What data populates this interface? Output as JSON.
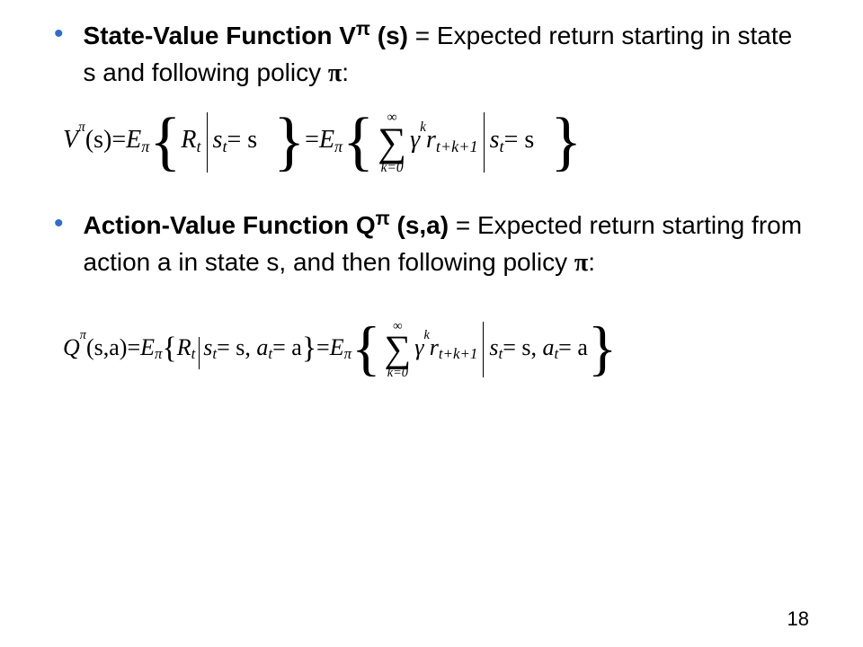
{
  "bullet1": {
    "title": "State-Value Function V",
    "title_sup": "π",
    "title_paren": " (s)",
    "desc": " = Expected return starting in state s and following policy ",
    "policy": "π",
    "colon": ":"
  },
  "eq1": {
    "V": "V",
    "pi": "π",
    "s_paren": "(s)",
    "eq": " = ",
    "E": "E",
    "lbrace": "{",
    "rbrace": "}",
    "R": "R",
    "t": "t",
    "mid": "|",
    "s_var": "s",
    "eq_s": " = s",
    "sum_top": "∞",
    "sum_bot": "k=0",
    "gamma": "γ",
    "k": "k",
    "r": "r",
    "tk1": "t+k+1"
  },
  "bullet2": {
    "title": "Action-Value Function Q",
    "title_sup": "π",
    "title_paren": " (s,a)",
    "desc": " = Expected return starting from action a in state s, and then following policy ",
    "policy": "π",
    "colon": ":"
  },
  "eq2": {
    "Q": "Q",
    "pi": "π",
    "sa_paren": "(s,a)",
    "eq": " = ",
    "E": "E",
    "R": "R",
    "t": "t",
    "s_var": "s",
    "eq_s": " = s",
    "a_var": "a",
    "eq_a": " = a",
    "sum_top": "∞",
    "sum_bot": "k=0",
    "gamma": "γ",
    "k": "k",
    "r": "r",
    "tk1": "t+k+1"
  },
  "page_number": "18"
}
